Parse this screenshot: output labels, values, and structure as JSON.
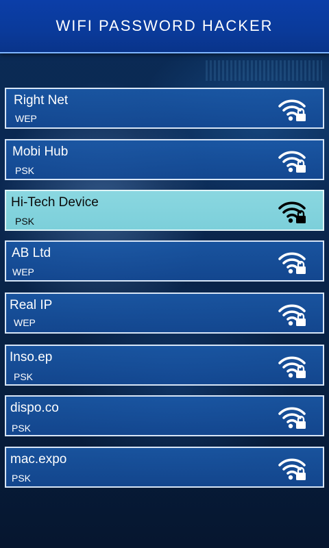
{
  "app": {
    "title": "WIFI PASSWORD HACKER"
  },
  "colors": {
    "header_bg": "#0a3a9a",
    "row_bg": "#1b5aaa",
    "row_selected_bg": "#86d4de",
    "icon_light": "#ffffff",
    "icon_dark": "#000000"
  },
  "networks": [
    {
      "name": "Right Net",
      "security": "WEP",
      "selected": false,
      "icon": "wifi-lock-icon"
    },
    {
      "name": "Mobi Hub",
      "security": "PSK",
      "selected": false,
      "icon": "wifi-lock-icon"
    },
    {
      "name": "Hi-Tech Device",
      "security": "PSK",
      "selected": true,
      "icon": "wifi-lock-icon"
    },
    {
      "name": "AB Ltd",
      "security": "WEP",
      "selected": false,
      "icon": "wifi-lock-icon"
    },
    {
      "name": "Real IP",
      "security": "WEP",
      "selected": false,
      "icon": "wifi-lock-icon"
    },
    {
      "name": "Inso.ep",
      "security": "PSK",
      "selected": false,
      "icon": "wifi-lock-icon"
    },
    {
      "name": "dispo.co",
      "security": "PSK",
      "selected": false,
      "icon": "wifi-lock-icon"
    },
    {
      "name": "mac.expo",
      "security": "PSK",
      "selected": false,
      "icon": "wifi-lock-icon"
    }
  ]
}
